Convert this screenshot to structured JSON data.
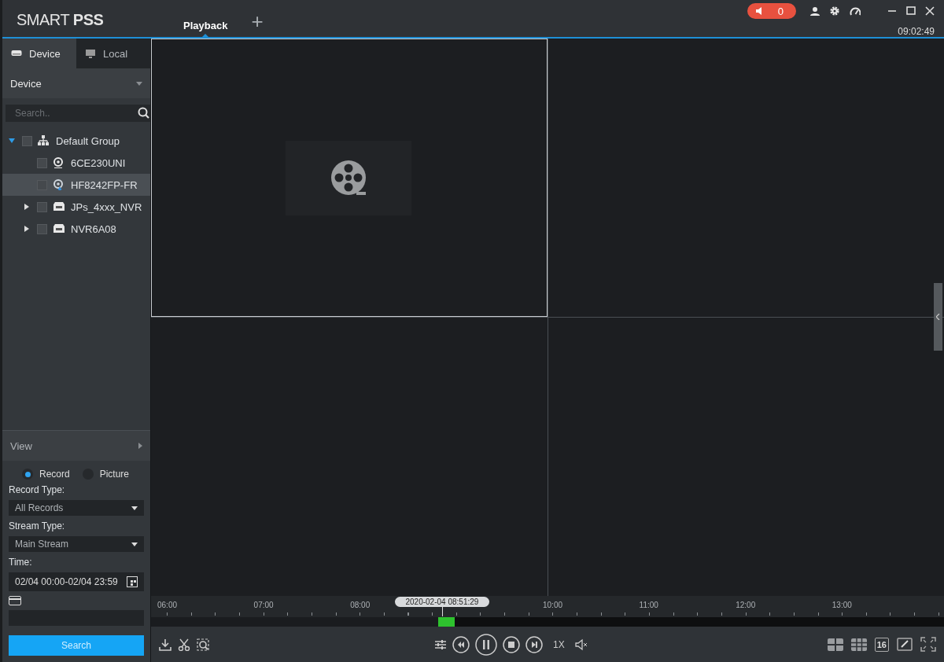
{
  "header": {
    "logo": "SMART **PSS**",
    "tabs": [
      {
        "label": "Playback",
        "selected": true
      }
    ],
    "add_tab": "+",
    "alarm_count": "0",
    "clock": "09:02:49"
  },
  "sidebar": {
    "tabs": [
      {
        "label": "Device",
        "kind": "device",
        "selected": true
      },
      {
        "label": "Local",
        "kind": "local",
        "selected": false
      }
    ],
    "device_dropdown": "Device",
    "search": {
      "placeholder": "Search.."
    },
    "tree": [
      {
        "label": "Default Group",
        "kind": "group",
        "expanded": true,
        "checked": false,
        "selected": false,
        "children": [
          {
            "label": "6CE230UNI",
            "kind": "camera",
            "checked": false,
            "selected": false
          },
          {
            "label": "HF8242FP-FR",
            "kind": "camera",
            "checked": false,
            "selected": true
          },
          {
            "label": "JPs_4xxx_NVR",
            "kind": "nvr",
            "expanded": false,
            "checked": false,
            "selected": false
          },
          {
            "label": "NVR6A08",
            "kind": "nvr",
            "expanded": false,
            "checked": false,
            "selected": false
          }
        ]
      }
    ],
    "view": "View",
    "mode": [
      {
        "label": "Record",
        "selected": true
      },
      {
        "label": "Picture",
        "selected": false
      }
    ],
    "record_type": {
      "label": "Record Type:",
      "value": "All Records"
    },
    "stream_type": {
      "label": "Stream Type:",
      "value": "Main Stream"
    },
    "time": {
      "label": "Time:",
      "value": "02/04 00:00-02/04 23:59"
    },
    "search_button": "Search"
  },
  "video_grid": {
    "cells": [
      {
        "selected": true,
        "kind": "empty-video"
      },
      {
        "selected": false,
        "kind": "blank"
      },
      {
        "selected": false,
        "kind": "blank"
      },
      {
        "selected": false,
        "kind": "blank"
      }
    ]
  },
  "timeline": {
    "labels_before_cursor": [
      "06:00",
      "07:00",
      "08:00"
    ],
    "labels_after_cursor": [
      "10:00",
      "11:00",
      "12:00",
      "13:00"
    ],
    "cursor": {
      "time": "2020-02-04 08:51:29",
      "level": 0.367
    }
  },
  "controls": {
    "speed": "1X",
    "layout_16": "16"
  }
}
